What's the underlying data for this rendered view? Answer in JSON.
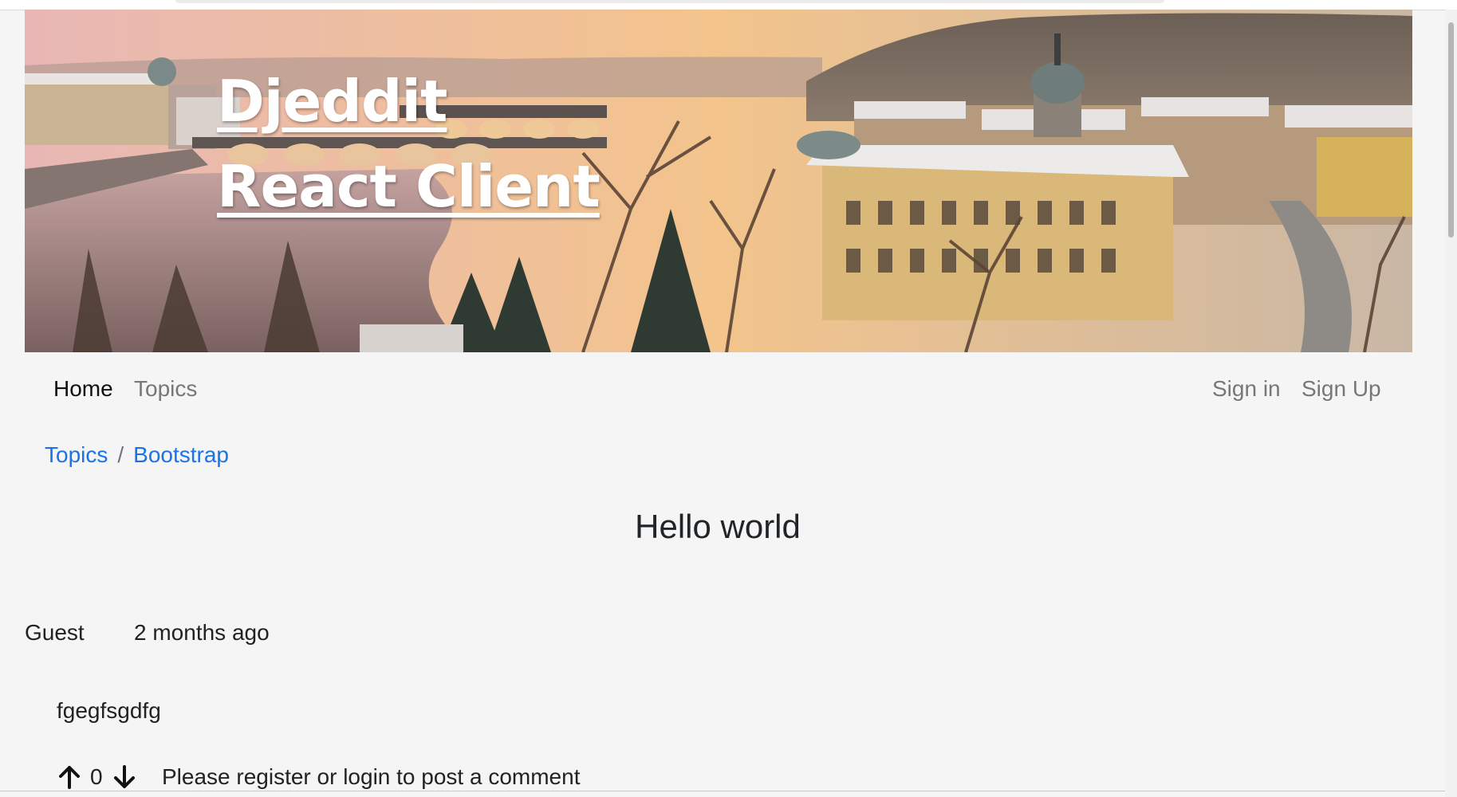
{
  "banner": {
    "title_line1": "Djeddit",
    "title_line2": "React Client"
  },
  "navbar": {
    "left_items": [
      {
        "label": "Home",
        "active": true
      },
      {
        "label": "Topics",
        "active": false
      }
    ],
    "right_items": [
      {
        "label": "Sign in"
      },
      {
        "label": "Sign Up"
      }
    ]
  },
  "breadcrumb": {
    "items": [
      "Topics",
      "Bootstrap"
    ],
    "separator": "/"
  },
  "post": {
    "title": "Hello world",
    "author": "Guest",
    "time": "2 months ago",
    "body": "fgegfsgdfg",
    "score": "0",
    "comment_prompt": "Please register or login to post a comment"
  },
  "colors": {
    "background": "#f5f5f5",
    "link_blue": "#1a73e8",
    "nav_muted": "#777777",
    "nav_active": "#111111"
  },
  "icons": {
    "upvote": "arrow-up-icon",
    "downvote": "arrow-down-icon"
  }
}
